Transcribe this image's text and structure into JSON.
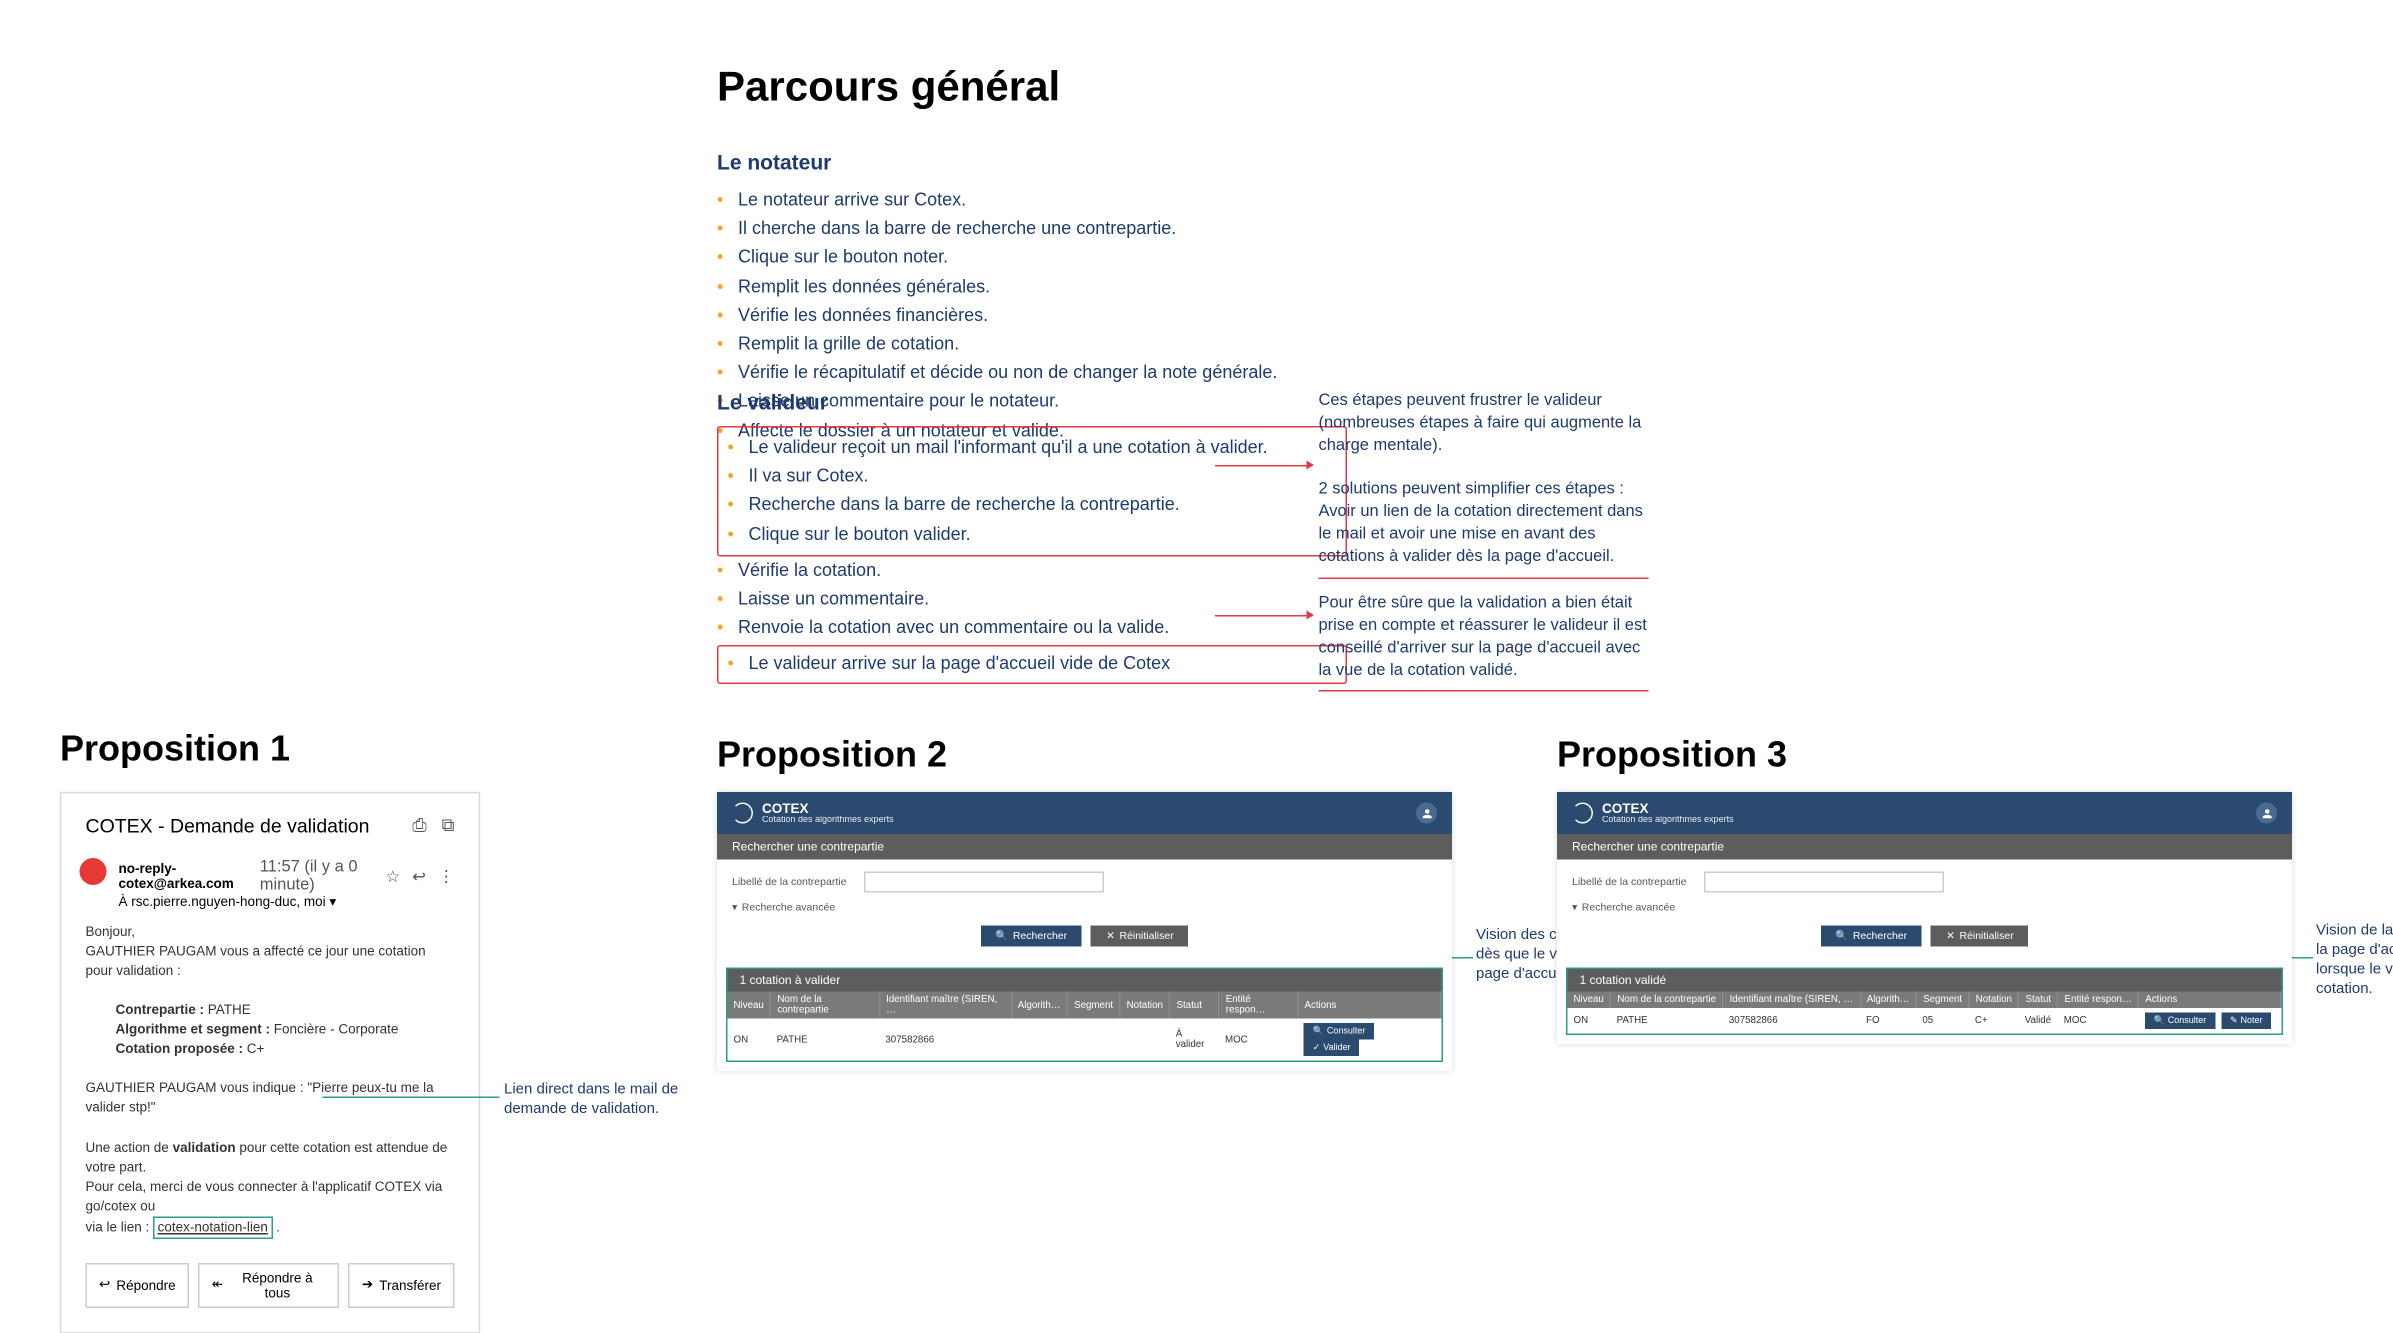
{
  "mainTitle": "Parcours général",
  "notateur": {
    "heading": "Le notateur",
    "items": [
      "Le notateur arrive sur Cotex.",
      "Il cherche dans la barre de recherche une contrepartie.",
      "Clique sur le bouton noter.",
      "Remplit les données générales.",
      "Vérifie les données financières.",
      "Remplit la grille de cotation.",
      "Vérifie le récapitulatif et décide ou non de changer la note générale.",
      "Laisse un commentaire pour le notateur.",
      "Affecte le dossier à un notateur et valide."
    ]
  },
  "valideur": {
    "heading": "Le valideur",
    "boxed1": [
      "Le valideur reçoit un mail l'informant qu'il a une cotation à valider.",
      "Il va sur Cotex.",
      "Recherche dans la barre de recherche la contrepartie.",
      "Clique sur le bouton valider."
    ],
    "middle": [
      "Vérifie la cotation.",
      "Laisse un commentaire.",
      "Renvoie la cotation avec un commentaire ou la valide."
    ],
    "boxed2": [
      "Le valideur arrive sur la page d'accueil vide de Cotex"
    ]
  },
  "annot1": {
    "p1": "Ces étapes peuvent frustrer le valideur (nombreuses étapes à faire qui augmente la charge mentale).",
    "p2": "2 solutions peuvent simplifier ces étapes :",
    "p3": "Avoir un lien de la cotation directement dans le mail et avoir une mise en avant des cotations à valider dès la page d'accueil."
  },
  "annot2": {
    "p1": "Pour être sûre que la validation a bien était prise en compte et réassurer le valideur il est conseillé d'arriver sur la page d'accueil avec la vue de la cotation validé."
  },
  "prop1": {
    "title": "Proposition 1",
    "emailSubject": "COTEX - Demande de validation",
    "sender": "no-reply-cotex@arkea.com",
    "recipients": "À rsc.pierre.nguyen-hong-duc, moi ▾",
    "time": "11:57 (il y a 0 minute)",
    "greeting": "Bonjour,",
    "intro": "GAUTHIER PAUGAM vous a affecté ce jour une cotation pour validation :",
    "details": {
      "contrepartieLabel": "Contrepartie :",
      "contrepartieValue": "PATHE",
      "algoLabel": "Algorithme et segment :",
      "algoValue": "Foncière - Corporate",
      "cotationLabel": "Cotation proposée :",
      "cotationValue": "C+"
    },
    "quote": "GAUTHIER PAUGAM vous indique : \"Pierre peux-tu me la valider stp!\"",
    "actionLine1": "Une action de",
    "actionBold": "validation",
    "actionLine1b": "pour cette cotation est attendue de votre part.",
    "actionLine2": "Pour cela, merci de vous connecter à l'applicatif COTEX via go/cotex ou",
    "actionLine3": "via le lien :",
    "link": "cotex-notation-lien",
    "btnReply": "Répondre",
    "btnReplyAll": "Répondre à tous",
    "btnForward": "Transférer",
    "annotation": "Lien direct dans le mail de demande de validation."
  },
  "prop2": {
    "title": "Proposition 2",
    "appTitle": "COTEX",
    "appSubtitle": "Cotation des algorithmes experts",
    "searchHeading": "Rechercher une contrepartie",
    "searchLabel": "Libellé de la contrepartie",
    "advSearch": "Recherche avancée",
    "btnSearch": "Rechercher",
    "btnReset": "Réinitialiser",
    "resultTitle": "1 cotation à valider",
    "columns": [
      "Niveau",
      "Nom de la contrepartie",
      "Identifiant maître (SIREN, …",
      "Algorith…",
      "Segment",
      "Notation",
      "Statut",
      "Entité respon…",
      "Actions"
    ],
    "row": {
      "niveau": "ON",
      "nom": "PATHE",
      "id": "307582866",
      "algo": "",
      "segment": "",
      "notation": "",
      "statut": "À valider",
      "entite": "MOC"
    },
    "btnConsulter": "Consulter",
    "btnValider": "Valider",
    "annotation": "Vision des cotations à valider dès que le valideur arrive sur la page d'accueil de Cotex."
  },
  "prop3": {
    "title": "Proposition 3",
    "appTitle": "COTEX",
    "appSubtitle": "Cotation des algorithmes experts",
    "searchHeading": "Rechercher une contrepartie",
    "searchLabel": "Libellé de la contrepartie",
    "advSearch": "Recherche avancée",
    "btnSearch": "Rechercher",
    "btnReset": "Réinitialiser",
    "resultTitle": "1 cotation validé",
    "columns": [
      "Niveau",
      "Nom de la contrepartie",
      "Identifiant maître (SIREN, …",
      "Algorith…",
      "Segment",
      "Notation",
      "Statut",
      "Entité respon…",
      "Actions"
    ],
    "row": {
      "niveau": "ON",
      "nom": "PATHE",
      "id": "307582866",
      "algo": "FO",
      "segment": "05",
      "notation": "C+",
      "statut": "Validé",
      "entite": "MOC"
    },
    "btnConsulter": "Consulter",
    "btnNoter": "Noter",
    "annotation": "Vision de la cotation validé sur la page d'accueil de Cotex, lorsque le valideur a validé la cotation."
  }
}
